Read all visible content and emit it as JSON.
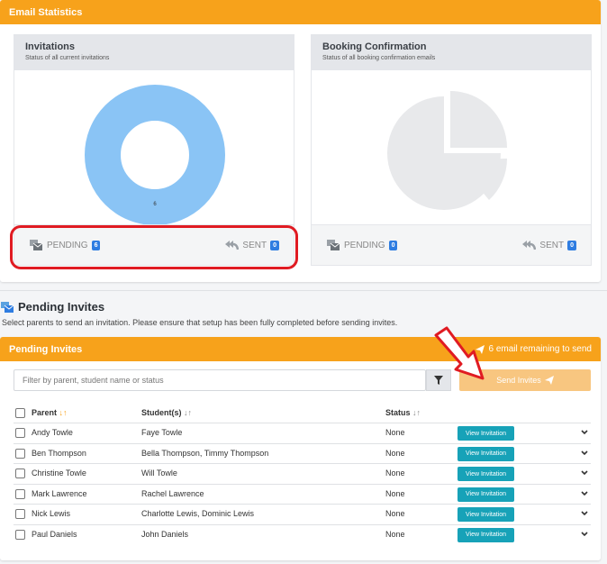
{
  "email_stats": {
    "header": "Email Statistics",
    "invitations": {
      "title": "Invitations",
      "subtitle": "Status of all current invitations",
      "donut_value": "6",
      "pending_label": "PENDING",
      "pending_count": "6",
      "sent_label": "SENT",
      "sent_count": "0",
      "donut_color": "#8ac4f5"
    },
    "booking": {
      "title": "Booking Confirmation",
      "subtitle": "Status of all booking confirmation emails",
      "pending_label": "PENDING",
      "pending_count": "0",
      "sent_label": "SENT",
      "sent_count": "0",
      "pie_color": "#e8e9eb"
    }
  },
  "pending_section": {
    "title": "Pending Invites",
    "description": "Select parents to send an invitation. Please ensure that setup has been fully completed before sending invites."
  },
  "pending_card": {
    "header": "Pending Invites",
    "remaining": "6 email remaining to send",
    "filter_placeholder": "Filter by parent, student name or status",
    "send_label": "Send Invites",
    "columns": {
      "parent": "Parent",
      "students": "Student(s)",
      "status": "Status"
    },
    "view_label": "View Invitation",
    "rows": [
      {
        "parent": "Andy Towle",
        "students": "Faye Towle",
        "status": "None"
      },
      {
        "parent": "Ben Thompson",
        "students": "Bella Thompson, Timmy Thompson",
        "status": "None"
      },
      {
        "parent": "Christine Towle",
        "students": "Will Towle",
        "status": "None"
      },
      {
        "parent": "Mark Lawrence",
        "students": "Rachel Lawrence",
        "status": "None"
      },
      {
        "parent": "Nick Lewis",
        "students": "Charlotte Lewis, Dominic Lewis",
        "status": "None"
      },
      {
        "parent": "Paul Daniels",
        "students": "John Daniels",
        "status": "None"
      }
    ]
  },
  "colors": {
    "accent": "#f7a21b",
    "badge": "#2f7de1",
    "view_button": "#17a2b8",
    "highlight": "#e01b22"
  }
}
